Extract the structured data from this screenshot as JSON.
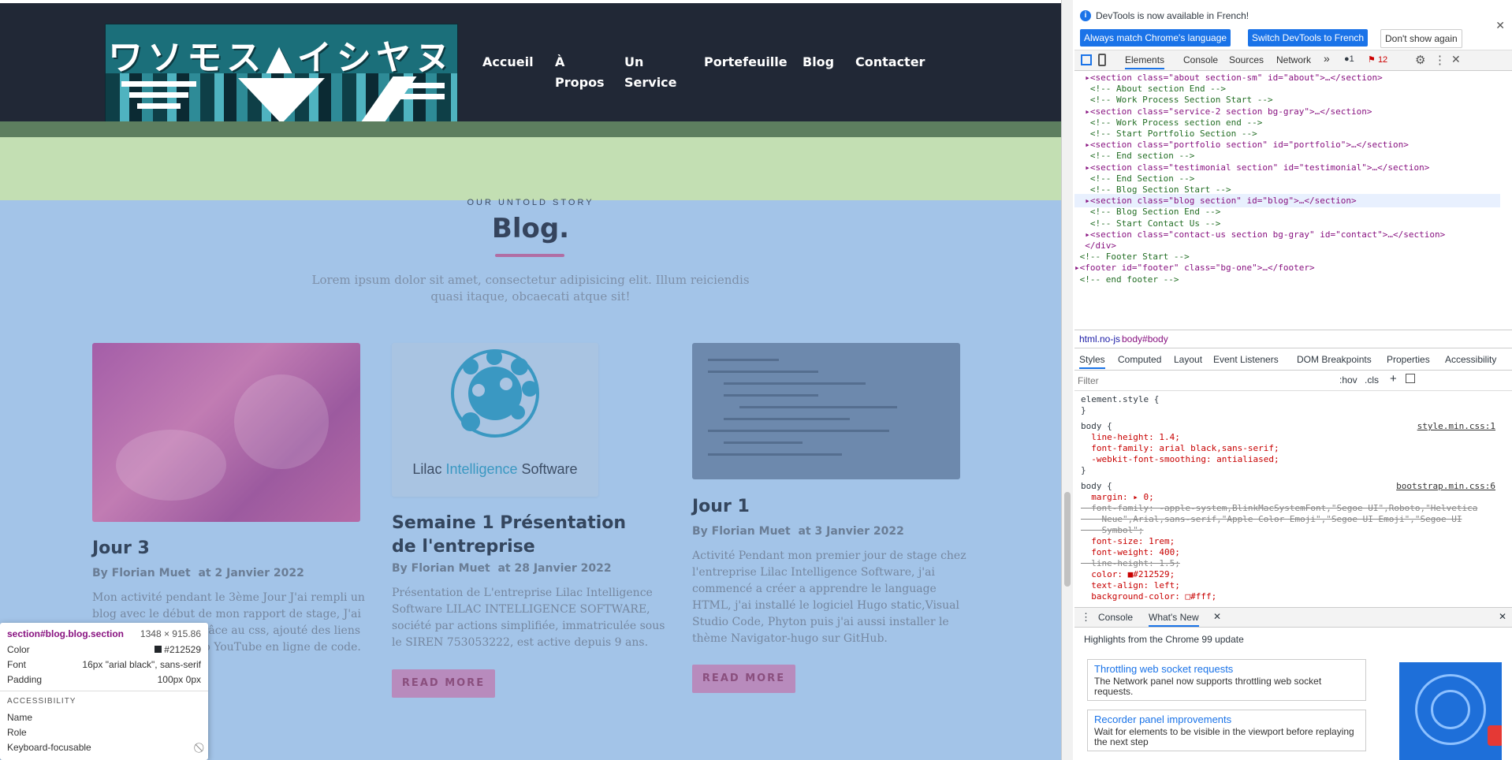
{
  "nav": {
    "logo_text": "ワソモス▲イシヤヌ",
    "links": [
      "Accueil",
      "À\nPropos",
      "Un\nService",
      "Portefeuille",
      "Blog",
      "Contacter"
    ]
  },
  "section": {
    "kicker": "OUR UNTOLD STORY",
    "title": "Blog.",
    "lead": "Lorem ipsum dolor sit amet, consectetur adipisicing elit. Illum reiciendis quasi itaque, obcaecati atque sit!"
  },
  "cards": [
    {
      "title": "Jour 3",
      "meta": "By Florian Muet  at 2 Janvier 2022",
      "text": "Mon activité pendant le 3ème Jour J'ai rempli un blog avec le début de mon rapport de stage, J'ai changés de police grâce au css, ajouté des liens et incrusté une vidéo YouTube en ligne de code.",
      "button": ""
    },
    {
      "title": "Semaine 1 Présentation de l'entreprise",
      "meta": "By Florian Muet  at 28 Janvier 2022",
      "text": "Présentation de L'entreprise Lilac Intelligence Software LILAC INTELLIGENCE SOFTWARE, société par actions simplifiée, immatriculée sous le SIREN 753053222, est active depuis 9 ans.",
      "button": "READ MORE",
      "logo_words": [
        "Lilac ",
        "Intelligence",
        " Software"
      ]
    },
    {
      "title": "Jour 1",
      "meta": "By Florian Muet  at 3 Janvier 2022",
      "text": "Activité Pendant mon premier jour de stage chez l'entreprise Lilac Intelligence Software, j'ai commencé a créer a apprendre le language HTML, j'ai installé le logiciel Hugo static,Visual Studio Code, Phyton puis j'ai aussi installer le thème Navigator-hugo sur GitHub.",
      "button": "READ MORE"
    }
  ],
  "inspect": {
    "selector": "section#blog.blog.section",
    "size": "1348 × 915.86",
    "rows": [
      {
        "k": "Color",
        "v": "#212529"
      },
      {
        "k": "Font",
        "v": "16px \"arial black\", sans-serif"
      },
      {
        "k": "Padding",
        "v": "100px 0px"
      }
    ],
    "accessibility_header": "ACCESSIBILITY",
    "a11y_rows": [
      "Name",
      "Role",
      "Keyboard-focusable"
    ]
  },
  "devtools": {
    "banner_text": "DevTools is now available in French!",
    "btn_match": "Always match Chrome's language",
    "btn_switch": "Switch DevTools to French",
    "btn_dont": "Don't show again",
    "tabs": [
      "Elements",
      "Console",
      "Sources",
      "Network",
      "»"
    ],
    "badge_errors": "1",
    "badge_issues": "12",
    "tree": [
      {
        "t": "tag",
        "s": "  ▸<section class=\"about section-sm\" id=\"about\">…</section>"
      },
      {
        "t": "cmt",
        "s": "   <!-- About section End -->"
      },
      {
        "t": "cmt",
        "s": "   <!-- Work Process Section Start -->"
      },
      {
        "t": "tag",
        "s": "  ▸<section class=\"service-2 section bg-gray\">…</section>"
      },
      {
        "t": "cmt",
        "s": "   <!-- Work Process section end -->"
      },
      {
        "t": "cmt",
        "s": "   <!-- Start Portfolio Section -->"
      },
      {
        "t": "tag",
        "s": "  ▸<section class=\"portfolio section\" id=\"portfolio\">…</section>"
      },
      {
        "t": "cmt",
        "s": "   <!-- End section -->"
      },
      {
        "t": "tag",
        "s": "  ▸<section class=\"testimonial section\" id=\"testimonial\">…</section>"
      },
      {
        "t": "cmt",
        "s": "   <!-- End Section -->"
      },
      {
        "t": "cmt",
        "s": "   <!-- Blog Section Start -->"
      },
      {
        "t": "sel",
        "s": "  ▸<section class=\"blog section\" id=\"blog\">…</section>"
      },
      {
        "t": "cmt",
        "s": "   <!-- Blog Section End -->"
      },
      {
        "t": "cmt",
        "s": "   <!-- Start Contact Us -->"
      },
      {
        "t": "tag",
        "s": "  ▸<section class=\"contact-us section bg-gray\" id=\"contact\">…</section>"
      },
      {
        "t": "tag",
        "s": "  </div>"
      },
      {
        "t": "cmt",
        "s": " <!-- Footer Start -->"
      },
      {
        "t": "tag",
        "s": "▸<footer id=\"footer\" class=\"bg-one\">…</footer>"
      },
      {
        "t": "cmt",
        "s": " <!-- end footer -->"
      }
    ],
    "crumbs": [
      "html.no-js",
      "body#body"
    ],
    "style_tabs": [
      "Styles",
      "Computed",
      "Layout",
      "Event Listeners",
      "DOM Breakpoints",
      "Properties",
      "Accessibility"
    ],
    "filter_placeholder": "Filter",
    "hov": ":hov",
    "cls": ".cls",
    "styles": [
      {
        "c": "plain",
        "s": "element.style {"
      },
      {
        "c": "plain",
        "s": "}"
      },
      {
        "c": "plain",
        "s": "body {",
        "src": "style.min.css:1"
      },
      {
        "c": "prop",
        "s": "  line-height: 1.4;"
      },
      {
        "c": "prop",
        "s": "  font-family: arial black,sans-serif;"
      },
      {
        "c": "prop",
        "s": "  -webkit-font-smoothing: antialiased;"
      },
      {
        "c": "plain",
        "s": "}"
      },
      {
        "c": "plain",
        "s": "body {",
        "src": "bootstrap.min.css:6"
      },
      {
        "c": "prop",
        "s": "  margin: ▸ 0;"
      },
      {
        "c": "strike",
        "s": "  font-family: -apple-system,BlinkMacSystemFont,\"Segoe UI\",Roboto,\"Helvetica"
      },
      {
        "c": "strike",
        "s": "    Neue\",Arial,sans-serif,\"Apple Color Emoji\",\"Segoe UI Emoji\",\"Segoe UI"
      },
      {
        "c": "strike",
        "s": "    Symbol\";"
      },
      {
        "c": "prop",
        "s": "  font-size: 1rem;"
      },
      {
        "c": "prop",
        "s": "  font-weight: 400;"
      },
      {
        "c": "strike",
        "s": "  line-height: 1.5;"
      },
      {
        "c": "prop",
        "s": "  color: ■#212529;"
      },
      {
        "c": "prop",
        "s": "  text-align: left;"
      },
      {
        "c": "prop",
        "s": "  background-color: □#fff;"
      }
    ],
    "drawer_tabs": [
      "Console",
      "What's New"
    ],
    "highlights": "Highlights from the Chrome 99 update",
    "news": [
      {
        "t": "Throttling web socket requests",
        "d": "The Network panel now supports throttling web socket requests."
      },
      {
        "t": "Recorder panel improvements",
        "d": "Wait for elements to be visible in the viewport before replaying the next step"
      }
    ]
  }
}
